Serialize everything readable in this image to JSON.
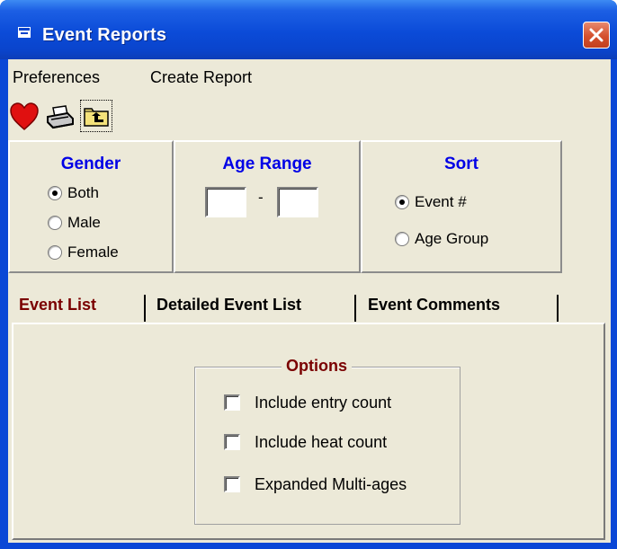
{
  "window": {
    "title": "Event Reports",
    "close_icon": "close-x-icon",
    "colors": {
      "title_bar": "#0a47d6",
      "client": "#ece9d8",
      "group_title": "#0000e6",
      "active_tab": "#7a0000",
      "close": "#d4502d"
    }
  },
  "menu": {
    "items": [
      "Preferences",
      "Create Report"
    ]
  },
  "toolbar": {
    "buttons": [
      {
        "icon": "heart-icon"
      },
      {
        "icon": "printer-icon"
      },
      {
        "icon": "folder-up-icon"
      }
    ]
  },
  "gender": {
    "title": "Gender",
    "options": [
      {
        "label": "Both",
        "selected": true
      },
      {
        "label": "Male",
        "selected": false
      },
      {
        "label": "Female",
        "selected": false
      }
    ]
  },
  "age_range": {
    "title": "Age Range",
    "from": "",
    "to": "",
    "separator": "-"
  },
  "sort": {
    "title": "Sort",
    "options": [
      {
        "label": "Event #",
        "selected": true
      },
      {
        "label": "Age Group",
        "selected": false
      }
    ]
  },
  "tabs": [
    {
      "label": "Event List",
      "active": true
    },
    {
      "label": "Detailed Event List",
      "active": false
    },
    {
      "label": "Event Comments",
      "active": false
    }
  ],
  "options": {
    "title": "Options",
    "checkboxes": [
      {
        "label": "Include entry count",
        "checked": false
      },
      {
        "label": "Include heat count",
        "checked": false
      },
      {
        "label": "Expanded Multi-ages",
        "checked": false
      }
    ]
  }
}
